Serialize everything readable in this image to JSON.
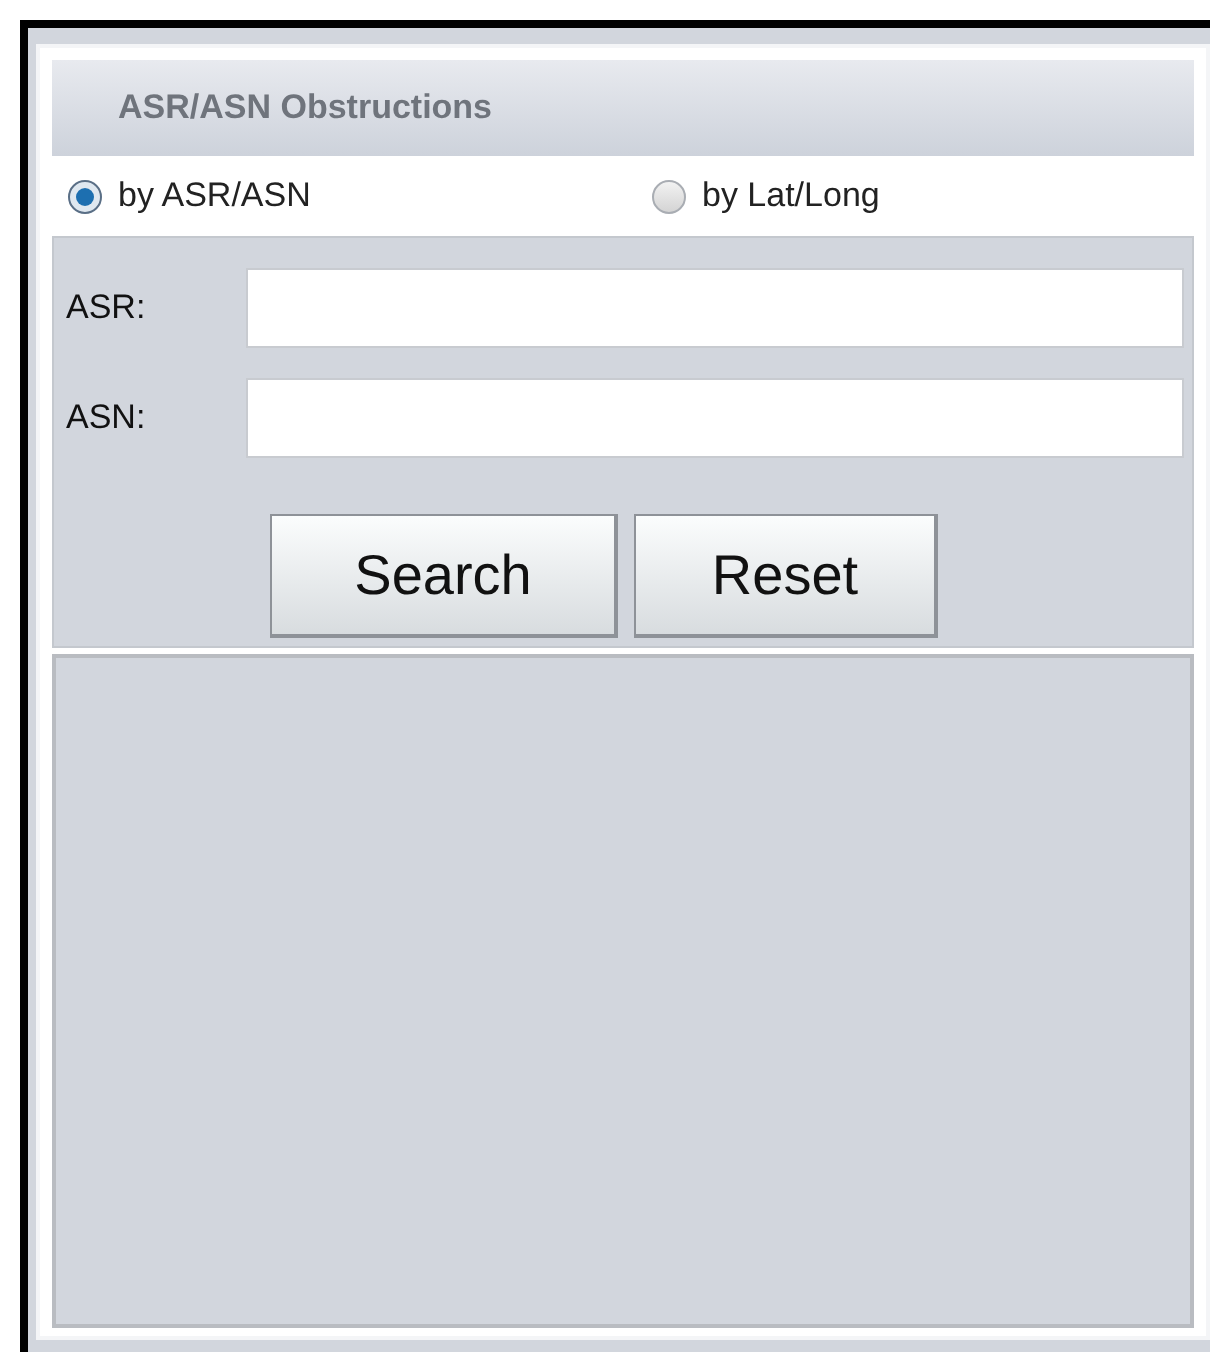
{
  "panel": {
    "title": "ASR/ASN Obstructions"
  },
  "modes": [
    {
      "label": "by ASR/ASN",
      "selected": true
    },
    {
      "label": "by Lat/Long",
      "selected": false
    }
  ],
  "fields": [
    {
      "label": "ASR:"
    },
    {
      "label": "ASN:"
    }
  ],
  "buttons": [
    "Search",
    "Reset"
  ]
}
